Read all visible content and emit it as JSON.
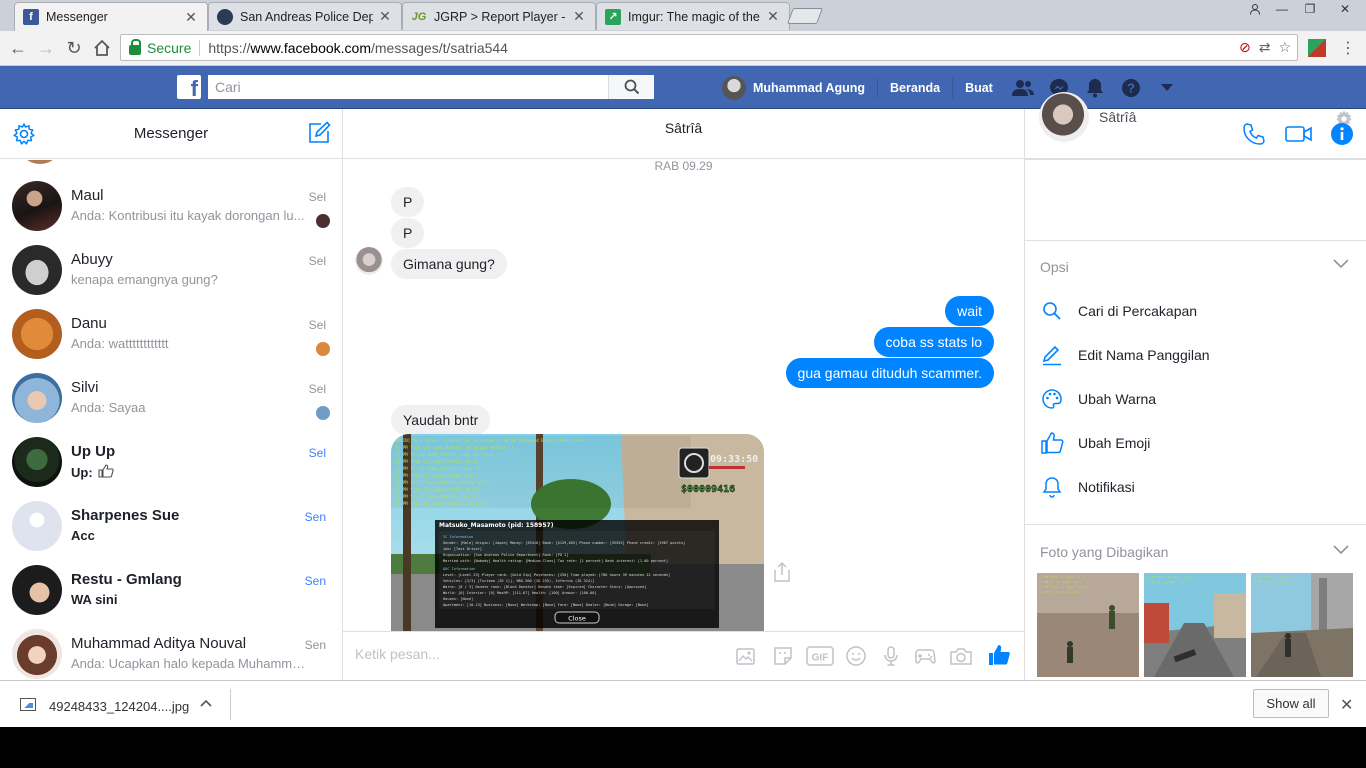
{
  "browser": {
    "tabs": [
      {
        "title": "Messenger",
        "icon": "facebook-icon",
        "active": true
      },
      {
        "title": "San Andreas Police Depa",
        "icon": "sapd-icon"
      },
      {
        "title": "JGRP > Report Player - Jo",
        "icon": "jgrp-icon"
      },
      {
        "title": "Imgur: The magic of the I",
        "icon": "imgur-icon"
      }
    ],
    "secure_label": "Secure",
    "url_prefix": "https://",
    "url_host": "www.facebook.com",
    "url_path": "/messages/t/satria544"
  },
  "fb": {
    "search_placeholder": "Cari",
    "user_name": "Muhammad Agung",
    "nav_home": "Beranda",
    "nav_create": "Buat"
  },
  "sidebar": {
    "title": "Messenger",
    "conversations": [
      {
        "name": "Maul",
        "snippet": "Anda: Kontribusi itu kayak dorongan lu...",
        "time": "Sel",
        "unread": false
      },
      {
        "name": "Abuyy",
        "snippet": "kenapa emangnya gung?",
        "time": "Sel",
        "unread": false
      },
      {
        "name": "Danu",
        "snippet": "Anda: watttttttttttt",
        "time": "Sel",
        "unread": false
      },
      {
        "name": "Silvi",
        "snippet": "Anda: Sayaa",
        "time": "Sel",
        "unread": false
      },
      {
        "name": "Up Up",
        "snippet": "Up:",
        "time": "Sel",
        "unread": true
      },
      {
        "name": "Sharpenes Sue",
        "snippet": "Acc",
        "time": "Sen",
        "unread": true
      },
      {
        "name": "Restu - Gmlang",
        "snippet": "WA sini",
        "time": "Sen",
        "unread": true
      },
      {
        "name": "Muhammad Aditya Nouval",
        "snippet": "Anda: Ucapkan halo kepada Muhamma...",
        "time": "Sen",
        "unread": false
      }
    ]
  },
  "chat": {
    "name": "Sâtrîâ",
    "timestamp": "RAB 09.29",
    "messages": [
      {
        "text": "P",
        "dir": "in"
      },
      {
        "text": "P",
        "dir": "in"
      },
      {
        "text": "Gimana gung?",
        "dir": "in"
      },
      {
        "text": "wait",
        "dir": "out"
      },
      {
        "text": "coba ss stats lo",
        "dir": "out"
      },
      {
        "text": "gua gamau dituduh scammer.",
        "dir": "out"
      },
      {
        "text": "Yaudah bntr",
        "dir": "in"
      }
    ],
    "composer_placeholder": "Ketik pesan..."
  },
  "screenshot": {
    "time": "09:33:50",
    "money": "$00009416",
    "dialog_title": "Matsuko_Masamoto (pid: 158957)",
    "close_label": "Close"
  },
  "details": {
    "name": "Sâtrîâ",
    "options_label": "Opsi",
    "options": [
      {
        "label": "Cari di Percakapan",
        "icon": "search-icon"
      },
      {
        "label": "Edit Nama Panggilan",
        "icon": "pencil-icon"
      },
      {
        "label": "Ubah Warna",
        "icon": "palette-icon"
      },
      {
        "label": "Ubah Emoji",
        "icon": "thumbs-up-icon"
      },
      {
        "label": "Notifikasi",
        "icon": "bell-icon"
      }
    ],
    "photos_label": "Foto yang Dibagikan"
  },
  "downloads": {
    "file_name": "49248433_124204....jpg",
    "show_all": "Show all"
  },
  "colors": {
    "fb_blue": "#4267b2",
    "messenger_blue": "#0084ff",
    "icon_blue": "#0084ff"
  }
}
